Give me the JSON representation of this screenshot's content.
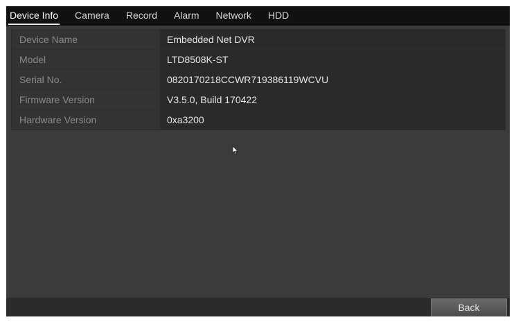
{
  "tabs": [
    {
      "label": "Device Info",
      "active": true
    },
    {
      "label": "Camera",
      "active": false
    },
    {
      "label": "Record",
      "active": false
    },
    {
      "label": "Alarm",
      "active": false
    },
    {
      "label": "Network",
      "active": false
    },
    {
      "label": "HDD",
      "active": false
    }
  ],
  "device_info": {
    "rows": [
      {
        "label": "Device Name",
        "value": "Embedded Net DVR"
      },
      {
        "label": "Model",
        "value": "LTD8508K-ST"
      },
      {
        "label": "Serial No.",
        "value": "0820170218CCWR719386119WCVU"
      },
      {
        "label": "Firmware Version",
        "value": "V3.5.0, Build 170422"
      },
      {
        "label": "Hardware Version",
        "value": "0xa3200"
      }
    ]
  },
  "footer": {
    "back_label": "Back"
  },
  "colors": {
    "panel_bg": "#3b3b3b",
    "tabbar_bg": "#111111",
    "label_text": "#8a8a8a",
    "value_text": "#e6e6e6"
  },
  "icons": {
    "cursor": "mouse-pointer-icon"
  }
}
